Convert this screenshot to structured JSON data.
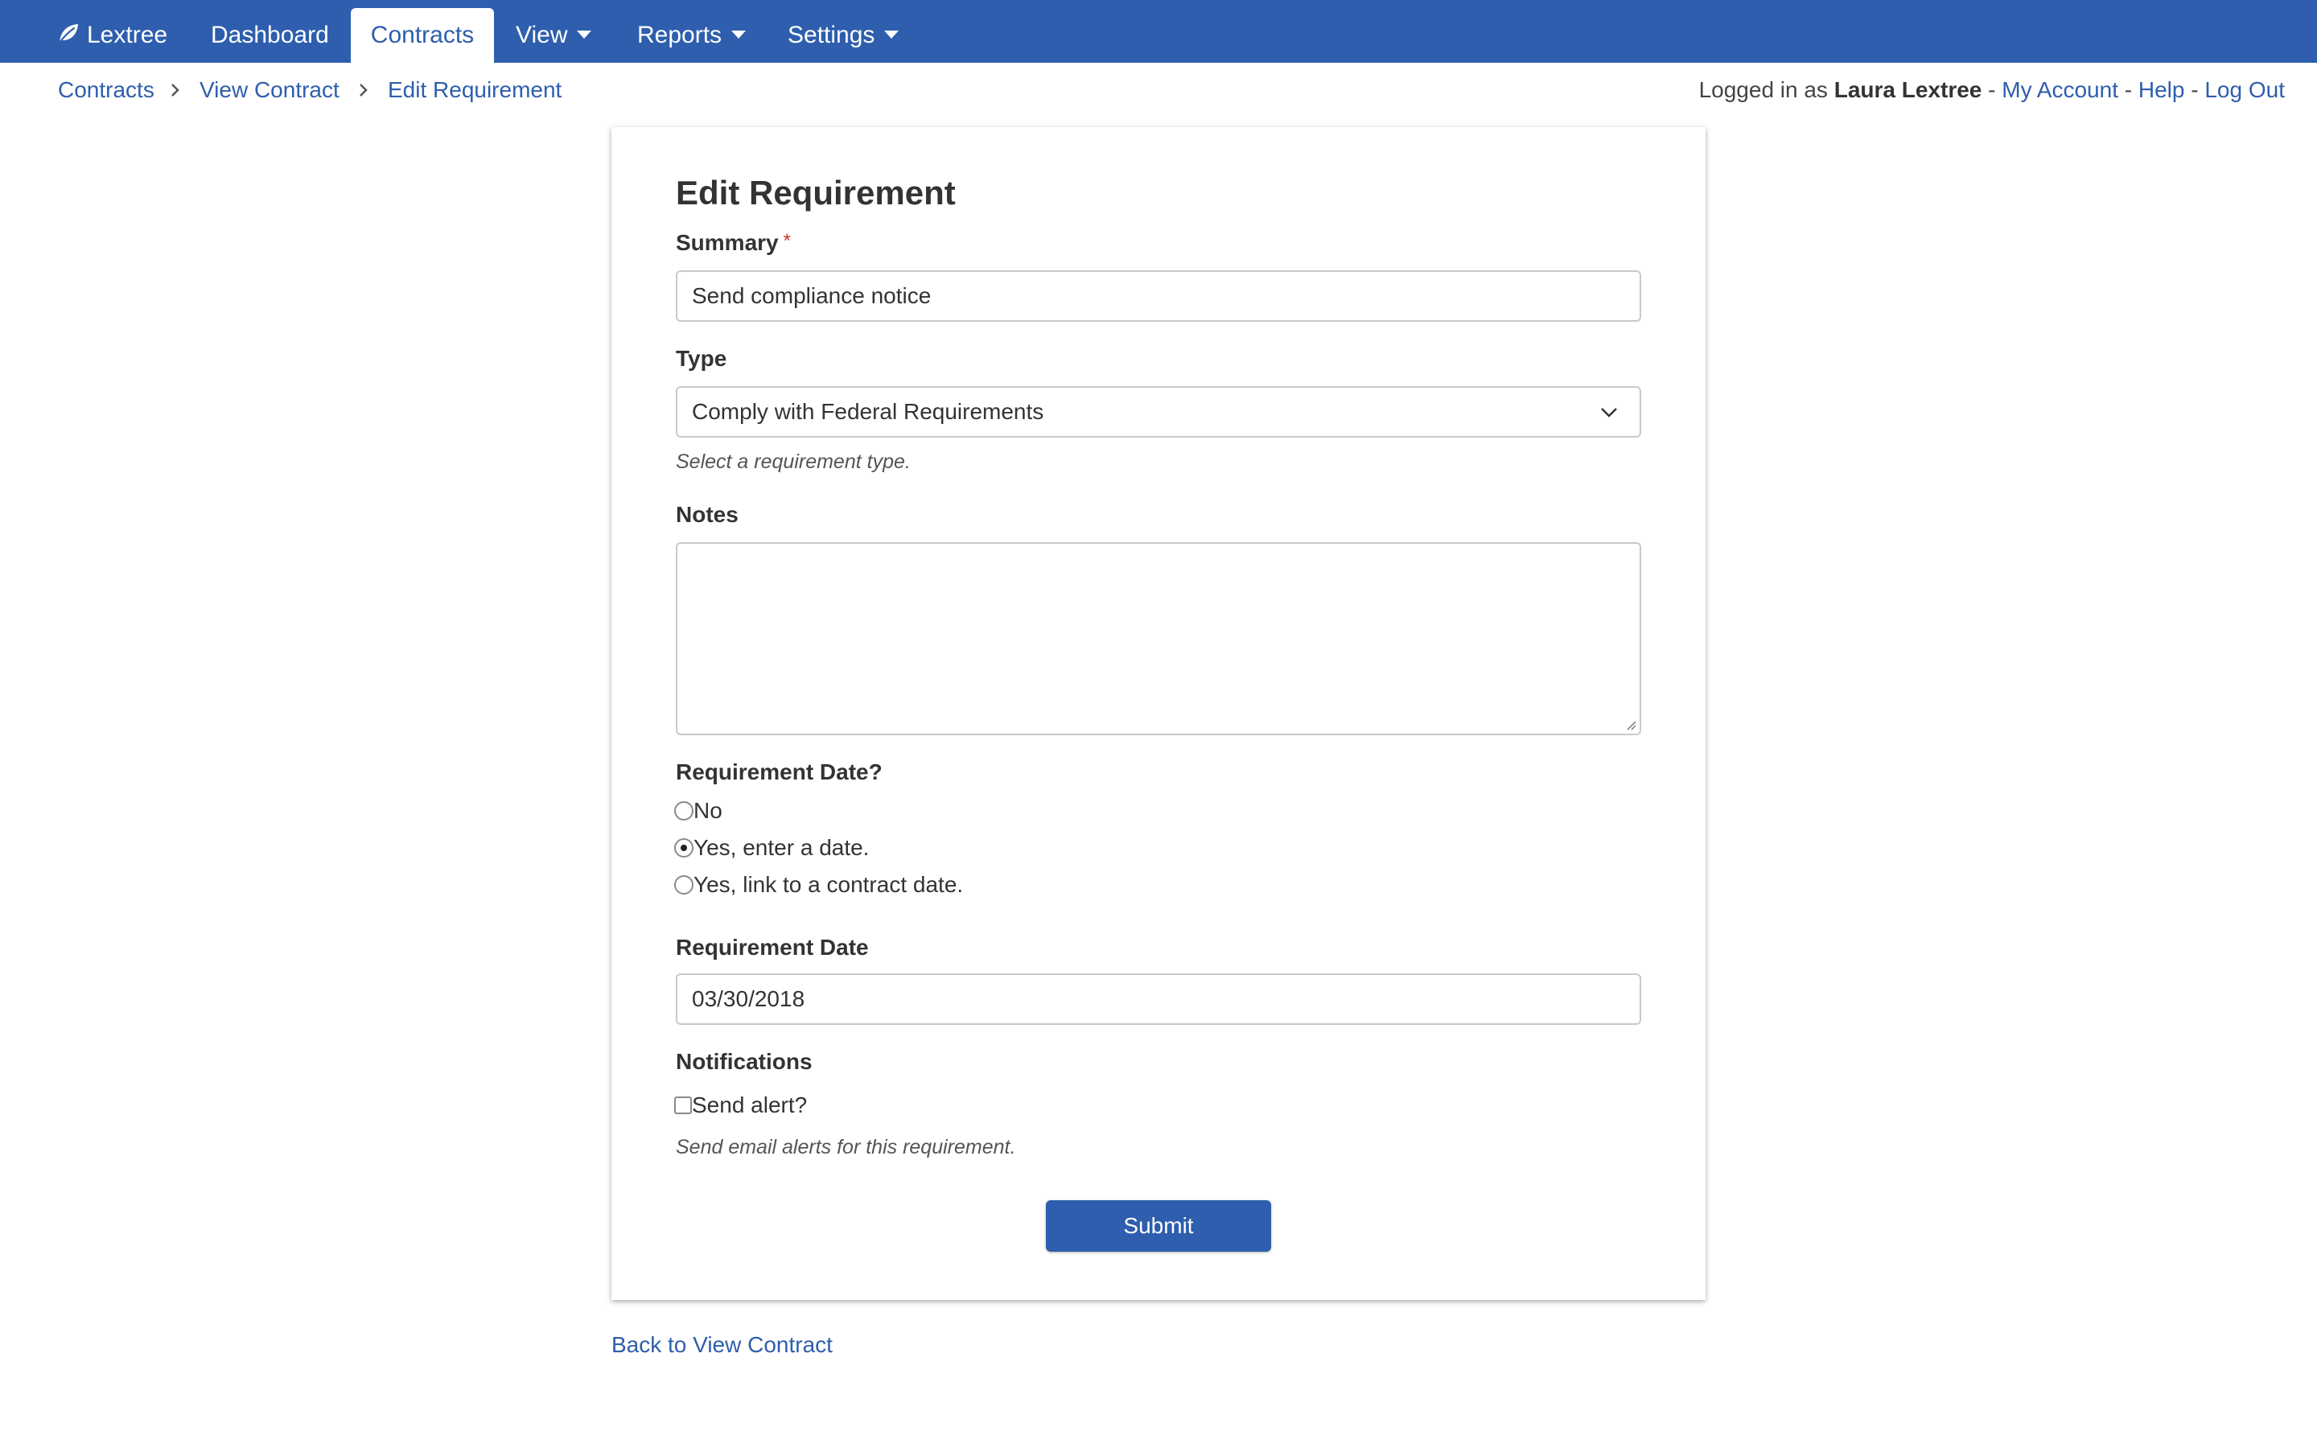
{
  "colors": {
    "brand": "#2e5ead",
    "required": "#d0312d"
  },
  "navbar": {
    "brand_icon": "leaf-icon",
    "brand_label": "Lextree",
    "items": [
      {
        "label": "Dashboard"
      },
      {
        "label": "Contracts"
      },
      {
        "label": "View"
      },
      {
        "label": "Reports"
      },
      {
        "label": "Settings"
      }
    ],
    "active_item": "Contracts"
  },
  "breadcrumb": {
    "items": [
      "Contracts",
      "View Contract",
      "Edit Requirement"
    ]
  },
  "user": {
    "prefix": "Logged in as",
    "name": "Laura Lextree",
    "sep": "-",
    "my_account": "My Account",
    "help": "Help",
    "log_out": "Log Out"
  },
  "form": {
    "title": "Edit Requirement",
    "summary": {
      "label": "Summary",
      "required_marker": "*",
      "value": "Send compliance notice"
    },
    "type": {
      "label": "Type",
      "value": "Comply with Federal Requirements",
      "help": "Select a requirement type."
    },
    "notes": {
      "label": "Notes",
      "value": ""
    },
    "requirement_date_choice": {
      "label": "Requirement Date?",
      "options": [
        {
          "label": "No",
          "checked": false
        },
        {
          "label": "Yes, enter a date.",
          "checked": true
        },
        {
          "label": "Yes, link to a contract date.",
          "checked": false
        }
      ]
    },
    "requirement_date": {
      "label": "Requirement Date",
      "value": "03/30/2018"
    },
    "notifications": {
      "label": "Notifications",
      "checkbox_label": "Send alert?",
      "checked": false,
      "help": "Send email alerts for this requirement."
    },
    "submit_label": "Submit"
  },
  "back_link": "Back to View Contract"
}
